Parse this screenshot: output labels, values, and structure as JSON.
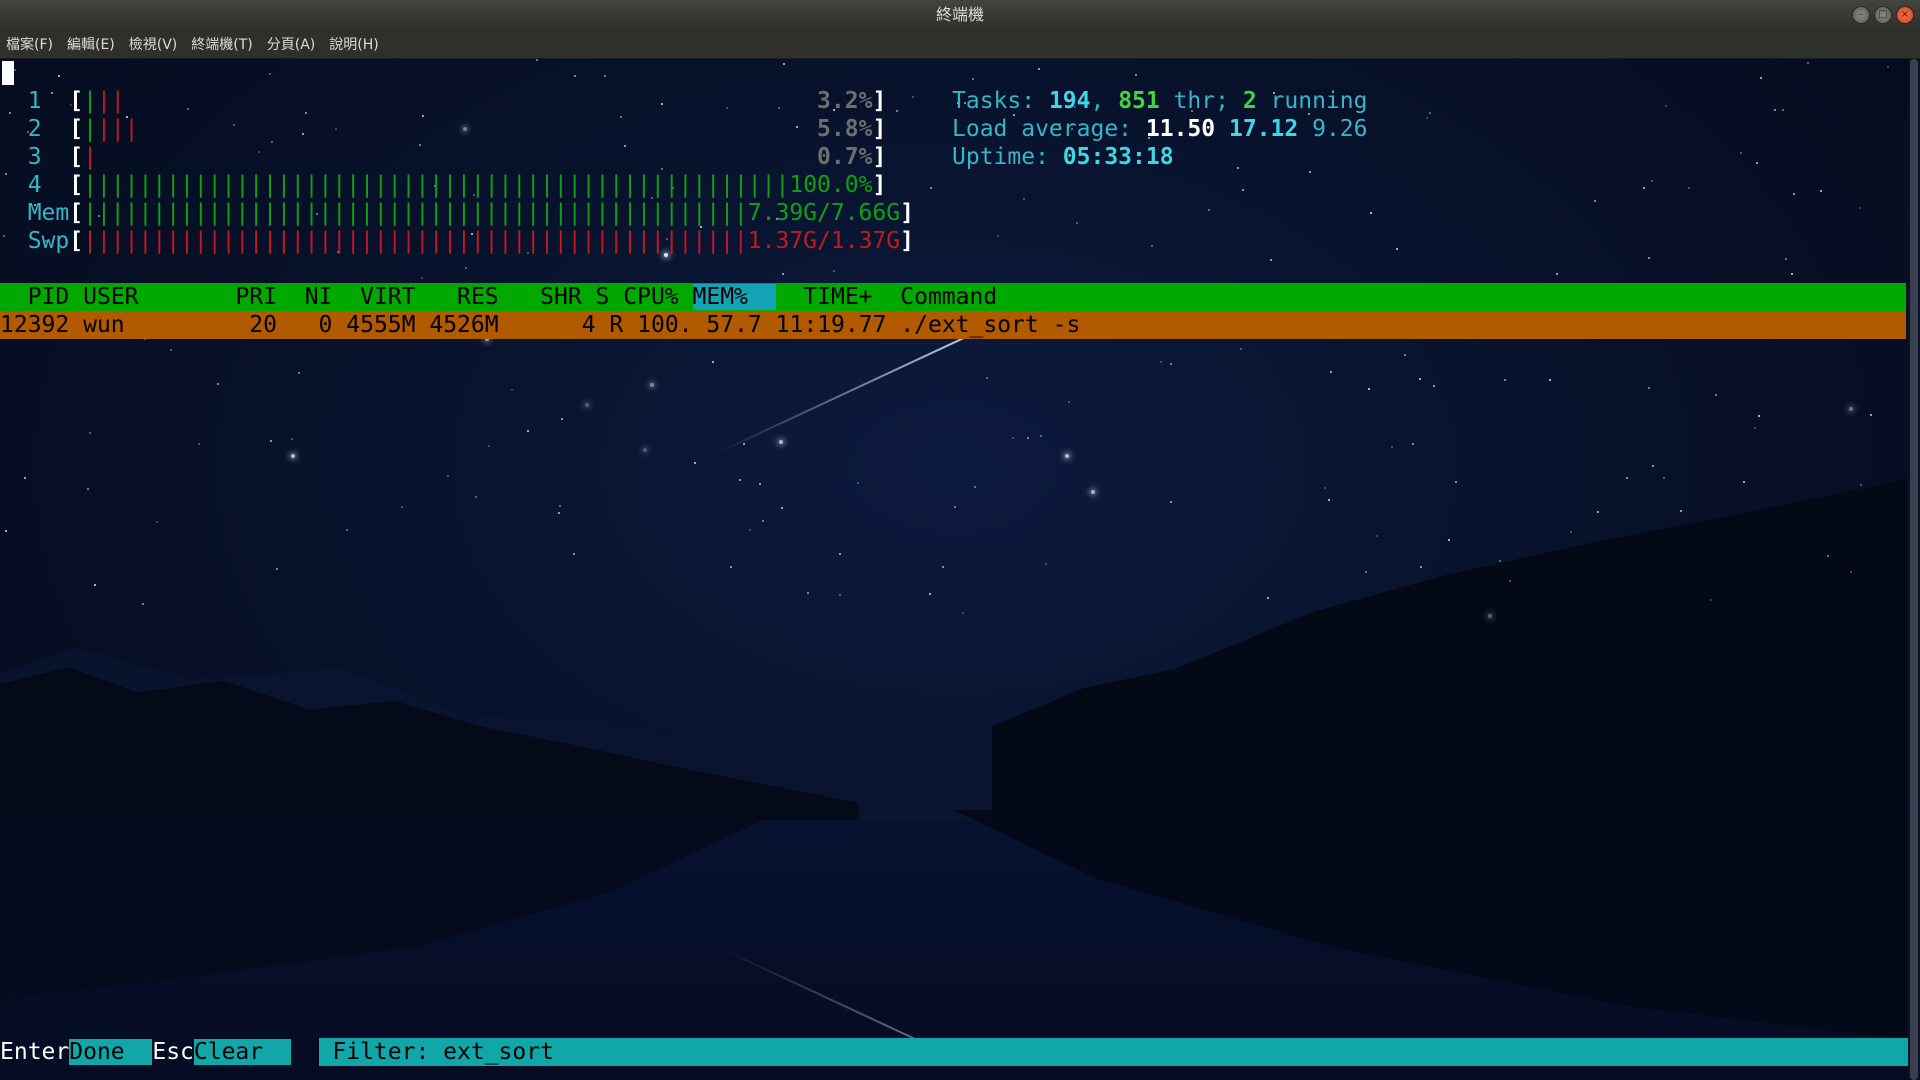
{
  "window": {
    "title": "終端機"
  },
  "menubar": {
    "items": [
      "檔案(F)",
      "編輯(E)",
      "檢視(V)",
      "終端機(T)",
      "分頁(A)",
      "說明(H)"
    ]
  },
  "meters": {
    "cpus": [
      {
        "label": "1",
        "value": "3.2%"
      },
      {
        "label": "2",
        "value": "5.8%"
      },
      {
        "label": "3",
        "value": "0.7%"
      },
      {
        "label": "4",
        "value": "100.0%"
      }
    ],
    "mem": {
      "label": "Mem",
      "value": "7.39G/7.66G"
    },
    "swp": {
      "label": "Swp",
      "value": "1.37G/1.37G"
    }
  },
  "summary": {
    "tasks_label": "Tasks: ",
    "tasks": "194",
    "thr": "851",
    "thr_label": " thr; ",
    "running": "2",
    "running_label": " running",
    "load_label": "Load average: ",
    "load1": "11.50",
    "load5": "17.12",
    "load15": "9.26",
    "uptime_label": "Uptime: ",
    "uptime": "05:33:18"
  },
  "table": {
    "columns": [
      "PID",
      "USER",
      "PRI",
      "NI",
      "VIRT",
      "RES",
      "SHR",
      "S",
      "CPU%",
      "MEM%",
      "TIME+",
      "Command"
    ],
    "sorted_column": "MEM%",
    "rows": [
      {
        "pid": "12392",
        "user": "wun",
        "pri": "20",
        "ni": "0",
        "virt": "4555M",
        "res": "4526M",
        "shr": "4",
        "s": "R",
        "cpu": "100.",
        "mem": "57.7",
        "time": "11:19.77",
        "command": "./ext_sort -s"
      }
    ]
  },
  "footer": {
    "enter_key": "Enter",
    "enter_label": "Done  ",
    "esc_key": "Esc",
    "esc_label": "Clear  ",
    "filter_text": " Filter: ext_sort"
  },
  "colors": {
    "header_bg": "#00a800",
    "selected_row_bg": "#b25a00",
    "sorted_col_bg": "#12a4b4",
    "footer_bg": "#11a7a9",
    "terminal_bg": "#08122c"
  }
}
